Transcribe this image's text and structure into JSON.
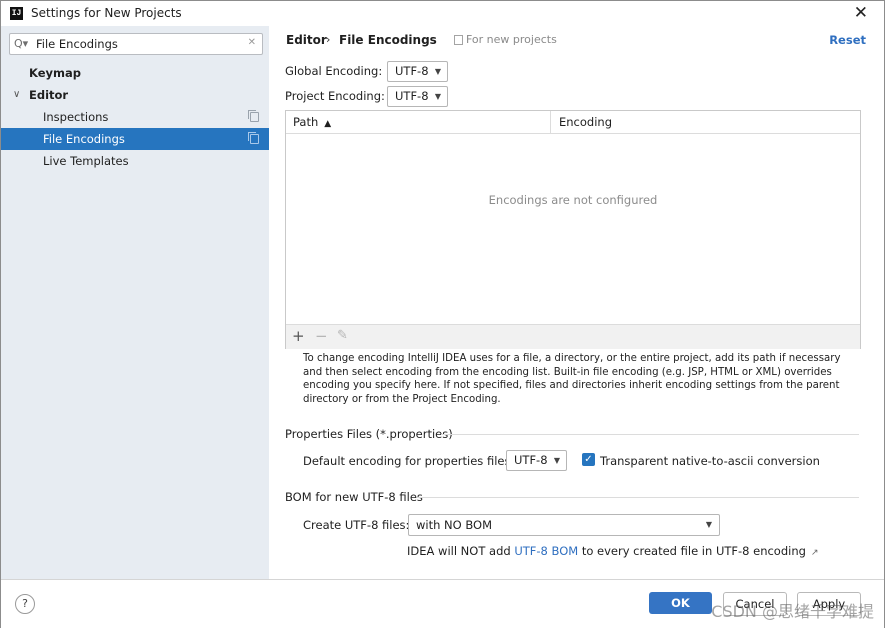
{
  "window": {
    "title": "Settings for New Projects",
    "app_icon_text": "IJ"
  },
  "search": {
    "value": "File Encodings"
  },
  "sidebar": {
    "items": [
      {
        "label": "Keymap"
      },
      {
        "label": "Editor"
      },
      {
        "label": "Inspections"
      },
      {
        "label": "File Encodings"
      },
      {
        "label": "Live Templates"
      }
    ]
  },
  "breadcrumb": {
    "parent": "Editor",
    "separator": "›",
    "current": "File Encodings",
    "scope": "For new projects"
  },
  "reset_label": "Reset",
  "global_encoding": {
    "label": "Global Encoding:",
    "value": "UTF-8"
  },
  "project_encoding": {
    "label": "Project Encoding:",
    "value": "UTF-8"
  },
  "table": {
    "columns": [
      "Path",
      "Encoding"
    ],
    "sort_indicator": "▲",
    "empty_text": "Encodings are not configured",
    "toolbar": {
      "add": "+",
      "remove": "−",
      "edit": "✎"
    }
  },
  "help_text": "To change encoding IntelliJ IDEA uses for a file, a directory, or the entire project, add its path if necessary and then select encoding from the encoding list. Built-in file encoding (e.g. JSP, HTML or XML) overrides encoding you specify here. If not specified, files and directories inherit encoding settings from the parent directory or from the Project Encoding.",
  "properties": {
    "section_title": "Properties Files (*.properties)",
    "default_label": "Default encoding for properties files:",
    "default_value": "UTF-8",
    "transparent_label": "Transparent native-to-ascii conversion",
    "transparent_checked": true
  },
  "bom": {
    "section_title": "BOM for new UTF-8 files",
    "create_label": "Create UTF-8 files:",
    "create_value": "with NO BOM",
    "note_prefix": "IDEA will NOT add ",
    "note_link": "UTF-8 BOM",
    "note_suffix": " to every created file in UTF-8 encoding"
  },
  "buttons": {
    "help": "?",
    "ok": "OK",
    "cancel": "Cancel",
    "apply": "Apply"
  },
  "watermark": "CSDN @思绪千字难提",
  "colors": {
    "accent": "#2675bf",
    "link": "#2f6fc0",
    "sidebar_bg": "#e7ecf2"
  }
}
